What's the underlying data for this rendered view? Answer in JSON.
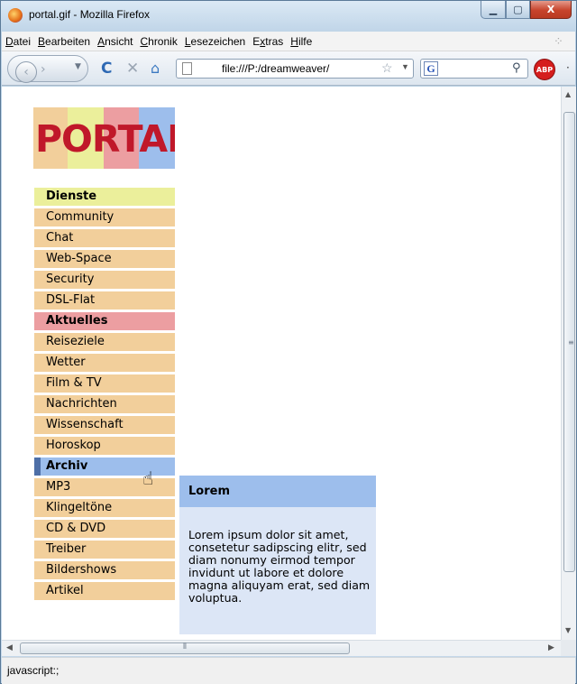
{
  "window": {
    "title": "portal.gif - Mozilla Firefox",
    "buttons": {
      "minimize": "▁",
      "maximize": "▢",
      "close": "X"
    }
  },
  "menubar": {
    "items": [
      {
        "accel": "D",
        "rest": "atei"
      },
      {
        "accel": "B",
        "rest": "earbeiten"
      },
      {
        "accel": "A",
        "rest": "nsicht"
      },
      {
        "accel": "C",
        "rest": "hronik"
      },
      {
        "accel": "L",
        "rest": "esezeichen"
      },
      {
        "pre": "E",
        "accel": "x",
        "rest": "tras"
      },
      {
        "accel": "H",
        "rest": "ilfe"
      }
    ]
  },
  "navbar": {
    "back_icon": "‹",
    "forward_icon": "›",
    "dropdown_icon": "▼",
    "reload_icon": "C",
    "stop_icon": "✕",
    "home_icon": "⌂",
    "url": "file:///P:/dreamweaver/",
    "star_icon": "☆",
    "search_engine": "G",
    "search_value": "",
    "search_go_icon": "⚲",
    "abp_label": "ABP",
    "more_icon": "·"
  },
  "page": {
    "logo_text": "PORTAL",
    "menu": [
      {
        "label": "Dienste",
        "type": "category",
        "section": "dienste"
      },
      {
        "label": "Community",
        "type": "item"
      },
      {
        "label": "Chat",
        "type": "item"
      },
      {
        "label": "Web-Space",
        "type": "item"
      },
      {
        "label": "Security",
        "type": "item"
      },
      {
        "label": "DSL-Flat",
        "type": "item"
      },
      {
        "label": "Aktuelles",
        "type": "category",
        "section": "aktuelles"
      },
      {
        "label": "Reiseziele",
        "type": "item"
      },
      {
        "label": "Wetter",
        "type": "item"
      },
      {
        "label": "Film & TV",
        "type": "item"
      },
      {
        "label": "Nachrichten",
        "type": "item"
      },
      {
        "label": "Wissenschaft",
        "type": "item"
      },
      {
        "label": "Horoskop",
        "type": "item"
      },
      {
        "label": "Archiv",
        "type": "category",
        "section": "archiv",
        "active": true
      },
      {
        "label": "MP3",
        "type": "item"
      },
      {
        "label": "Klingeltöne",
        "type": "item"
      },
      {
        "label": "CD & DVD",
        "type": "item"
      },
      {
        "label": "Treiber",
        "type": "item"
      },
      {
        "label": "Bildershows",
        "type": "item"
      },
      {
        "label": "Artikel",
        "type": "item"
      }
    ],
    "lorem": {
      "title": "Lorem",
      "body": "Lorem ipsum dolor sit amet, consetetur sadipscing elitr, sed diam nonumy eirmod tempor invidunt ut labore et dolore magna aliquyam erat, sed diam voluptua."
    },
    "colors": {
      "dienste": "#ebef9b",
      "aktuelles": "#ec9ea1",
      "archiv": "#9dbeec",
      "item": "#f2cf9b",
      "logo_red": "#c0182a"
    }
  },
  "scrollbars": {
    "up": "▲",
    "down": "▼",
    "left": "◀",
    "right": "▶",
    "grip_v": "≡",
    "grip_h": "⦀"
  },
  "status": {
    "text": "javascript:;"
  }
}
